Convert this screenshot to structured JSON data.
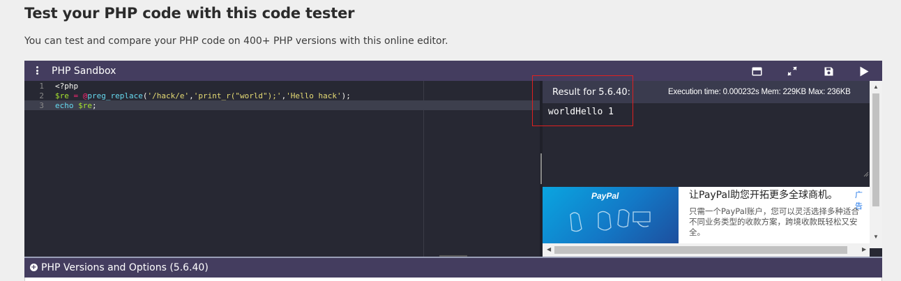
{
  "page": {
    "title": "Test your PHP code with this code tester",
    "description": "You can test and compare your PHP code on 400+ PHP versions with this online editor."
  },
  "sandbox": {
    "title": "PHP Sandbox",
    "toolbar": {
      "icons": [
        "layout-icon",
        "fullscreen-icon",
        "save-icon",
        "run-icon"
      ]
    },
    "editor": {
      "lines": [
        {
          "number": "1",
          "text": "<?php"
        },
        {
          "number": "2",
          "text": "$re = @preg_replace('/hack/e','print_r(\"world\");','Hello hack');"
        },
        {
          "number": "3",
          "text": "echo $re;"
        }
      ],
      "line2_parts": {
        "var": "$re",
        "op": " = ",
        "at": "@",
        "fn": "preg_replace",
        "p1": "(",
        "s1": "'/hack/e'",
        "c1": ",",
        "s2": "'print_r(\"world\");'",
        "c2": ",",
        "s3": "'Hello hack'",
        "p2": ");"
      },
      "line3_parts": {
        "kw": "echo",
        "var": " $re",
        "end": ";"
      }
    },
    "result": {
      "label": "Result for 5.6.40:",
      "execution_info": "Execution time: 0.000232s Mem: 229KB Max: 236KB",
      "output": "worldHello 1"
    },
    "ad": {
      "brand": "PayPal",
      "headline": "让PayPal助您开拓更多全球商机。",
      "tag": "广告",
      "body": "只需一个PayPal账户，您可以灵活选择多种适合不同业务类型的收款方案，跨境收款既轻松又安全。"
    },
    "options_bar": {
      "label": "PHP Versions and Options (5.6.40)"
    }
  },
  "colors": {
    "accent_bar": "#443d5f",
    "editor_bg": "#272833",
    "highlight": "#e02020"
  }
}
